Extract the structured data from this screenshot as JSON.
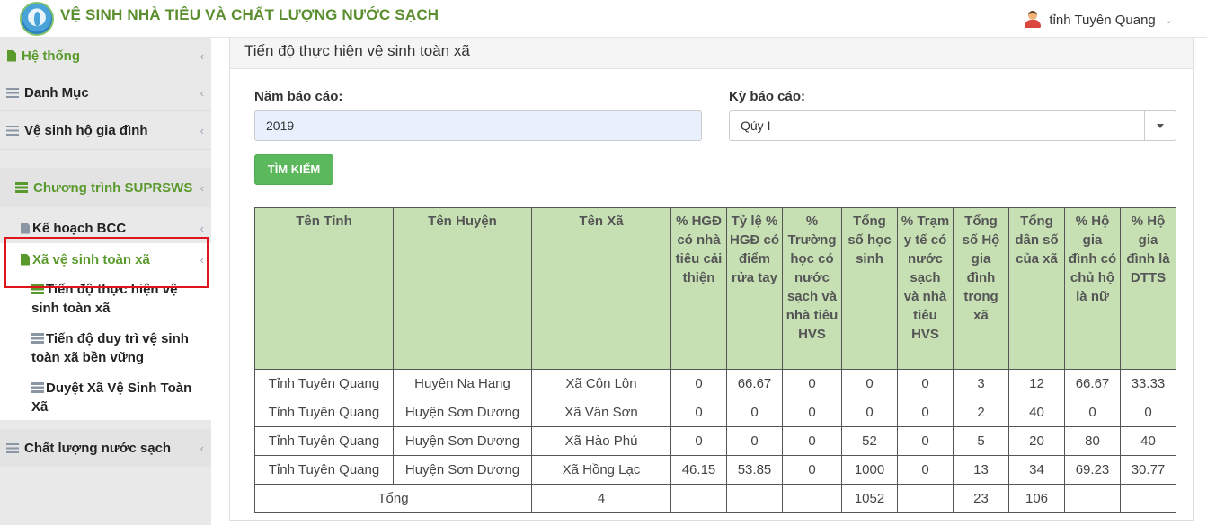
{
  "app": {
    "title": "VỆ SINH NHÀ TIÊU VÀ CHẤT LƯỢNG NƯỚC SẠCH",
    "user": "tỉnh Tuyên Quang"
  },
  "sidebar": {
    "items": [
      {
        "label": "Hệ thống"
      },
      {
        "label": "Danh Mục"
      },
      {
        "label": "Vệ sinh hộ gia đình"
      },
      {
        "label": "Chương trình SUPRSWS"
      },
      {
        "label": "Kế hoạch BCC"
      },
      {
        "label": "Xã vệ sinh toàn xã"
      },
      {
        "label": "Tiến độ thực hiện vệ sinh toàn xã"
      },
      {
        "label": "Tiến độ duy trì vệ sinh toàn xã bền vững"
      },
      {
        "label": "Duyệt Xã Vệ Sinh Toàn Xã"
      },
      {
        "label": "Chất lượng nước sạch"
      }
    ]
  },
  "main": {
    "title": "Tiến độ thực hiện vệ sinh toàn xã",
    "year_label": "Năm báo cáo:",
    "year_value": "2019",
    "period_label": "Kỳ báo cáo:",
    "period_value": "Qúy I",
    "search_label": "TÌM KIẾM"
  },
  "table": {
    "headers": [
      "Tên Tỉnh",
      "Tên Huyện",
      "Tên Xã",
      "% HGĐ có nhà tiêu cải thiện",
      "Tỷ lệ % HGĐ có điểm rửa tay",
      "% Trường học có nước sạch và nhà tiêu HVS",
      "Tổng số học sinh",
      "% Trạm y tế có nước sạch và nhà tiêu HVS",
      "Tổng số Hộ gia đình trong xã",
      "Tổng dân số của xã",
      "% Hộ gia đình có chủ hộ là nữ",
      "% Hộ gia đình là DTTS"
    ],
    "rows": [
      [
        "Tỉnh Tuyên Quang",
        "Huyện Na Hang",
        "Xã Côn Lôn",
        "0",
        "66.67",
        "0",
        "0",
        "0",
        "3",
        "12",
        "66.67",
        "33.33"
      ],
      [
        "Tỉnh Tuyên Quang",
        "Huyện Sơn Dương",
        "Xã Vân Sơn",
        "0",
        "0",
        "0",
        "0",
        "0",
        "2",
        "40",
        "0",
        "0"
      ],
      [
        "Tỉnh Tuyên Quang",
        "Huyện Sơn Dương",
        "Xã Hào Phú",
        "0",
        "0",
        "0",
        "52",
        "0",
        "5",
        "20",
        "80",
        "40"
      ],
      [
        "Tỉnh Tuyên Quang",
        "Huyện Sơn Dương",
        "Xã Hồng Lạc",
        "46.15",
        "53.85",
        "0",
        "1000",
        "0",
        "13",
        "34",
        "69.23",
        "30.77"
      ]
    ],
    "total": {
      "label": "Tổng",
      "communes": "4",
      "students": "1052",
      "households": "23",
      "population": "106"
    }
  }
}
